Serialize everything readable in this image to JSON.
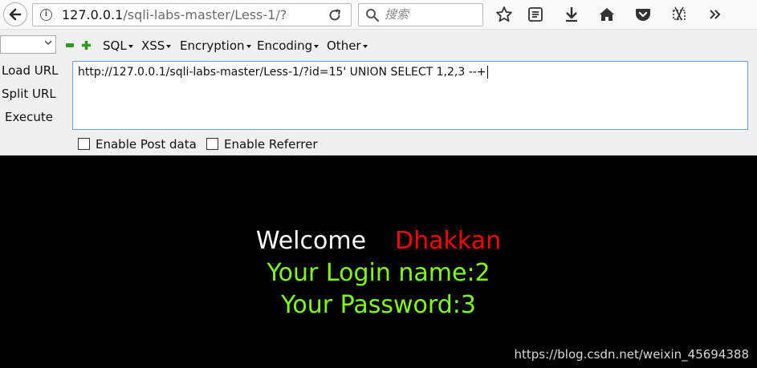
{
  "browser": {
    "url_host": "127.0.0.1",
    "url_path": "/sqli-labs-master/Less-1/?",
    "search_placeholder": "搜索",
    "toolbar_icons": [
      "star-icon",
      "reading-list-icon",
      "download-icon",
      "home-icon",
      "pocket-icon",
      "screenshot-icon",
      "overflow-chevron-icon"
    ]
  },
  "hackbar": {
    "menus": [
      "SQL",
      "XSS",
      "Encryption",
      "Encoding",
      "Other"
    ],
    "load_url": "Load URL",
    "split_url": "Split URL",
    "execute": "Execute",
    "url_value": "http://127.0.0.1/sqli-labs-master/Less-1/?id=15' UNION SELECT 1,2,3 --+",
    "enable_post": "Enable Post data",
    "enable_referrer": "Enable Referrer"
  },
  "page": {
    "welcome": "Welcome",
    "name": "Dhakkan",
    "login_line": "Your Login name:2",
    "password_line": "Your Password:3",
    "colors": {
      "welcome": "#ffffff",
      "name": "#ff0000",
      "result": "#7fff00",
      "background": "#000000"
    }
  },
  "watermark": "https://blog.csdn.net/weixin_45694388"
}
